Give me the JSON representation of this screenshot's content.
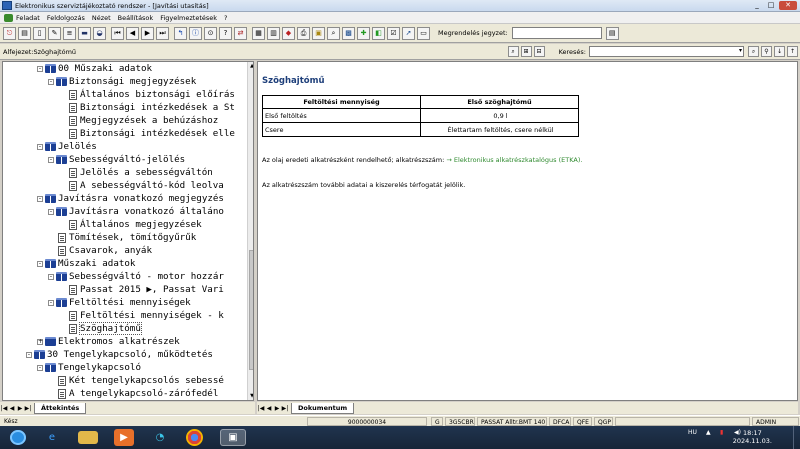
{
  "window": {
    "title": "Elektronikus szerviztájékoztató rendszer - [Javítási utasítás]",
    "minimize": "_",
    "maximize": "□",
    "close": "✕"
  },
  "menu": [
    "Feladat",
    "Feldolgozás",
    "Nézet",
    "Beállítások",
    "Figyelmeztetések",
    "?"
  ],
  "toolbar": {
    "order_label": "Megrendelés jegyzet:",
    "order_value": ""
  },
  "pathbar": {
    "path": "Alfejezet:Szöghajtómű",
    "search_label": "Keresés:",
    "search_value": ""
  },
  "tree": {
    "items": [
      {
        "label": "00 Műszaki adatok",
        "level": 0,
        "type": "book",
        "expander": "-"
      },
      {
        "label": "Biztonsági megjegyzések",
        "level": 1,
        "type": "book",
        "expander": "-"
      },
      {
        "label": "Általános biztonsági előírás",
        "level": 2,
        "type": "page"
      },
      {
        "label": "Biztonsági intézkedések a St",
        "level": 2,
        "type": "page"
      },
      {
        "label": "Megjegyzések a behúzáshoz",
        "level": 2,
        "type": "page"
      },
      {
        "label": "Biztonsági intézkedések elle",
        "level": 2,
        "type": "page"
      },
      {
        "label": "Jelölés",
        "level": 0,
        "type": "book",
        "expander": "-"
      },
      {
        "label": "Sebességváltó-jelölés",
        "level": 1,
        "type": "book",
        "expander": "-"
      },
      {
        "label": "Jelölés a sebességváltón",
        "level": 2,
        "type": "page"
      },
      {
        "label": "A sebességváltó-kód leolva",
        "level": 2,
        "type": "page"
      },
      {
        "label": "Javításra vonatkozó megjegyzés",
        "level": 0,
        "type": "book",
        "expander": "-"
      },
      {
        "label": "Javításra vonatkozó általáno",
        "level": 1,
        "type": "book",
        "expander": "-"
      },
      {
        "label": "Általános megjegyzések",
        "level": 2,
        "type": "page"
      },
      {
        "label": "Tömítések, tömítőgyűrűk",
        "level": 1,
        "type": "page"
      },
      {
        "label": "Csavarok, anyák",
        "level": 1,
        "type": "page"
      },
      {
        "label": "Műszaki adatok",
        "level": 0,
        "type": "book",
        "expander": "-"
      },
      {
        "label": "Sebességváltó - motor hozzár",
        "level": 1,
        "type": "book",
        "expander": "-"
      },
      {
        "label": "Passat 2015 ▶, Passat Vari",
        "level": 2,
        "type": "page"
      },
      {
        "label": "Feltöltési mennyiségek",
        "level": 1,
        "type": "book",
        "expander": "-"
      },
      {
        "label": "Feltöltési mennyiségek - k",
        "level": 2,
        "type": "page"
      },
      {
        "label": "Szöghajtómű",
        "level": 2,
        "type": "page",
        "selected": true
      },
      {
        "label": "Elektromos alkatrészek",
        "level": 0,
        "type": "bookclosed",
        "expander": "+"
      },
      {
        "label": "30 Tengelykapcsoló, működtetés",
        "level": -1,
        "type": "book",
        "expander": "-"
      },
      {
        "label": "Tengelykapcsoló",
        "level": 0,
        "type": "book",
        "expander": "-"
      },
      {
        "label": "Két tengelykapcsolós sebessé",
        "level": 1,
        "type": "page"
      },
      {
        "label": "A tengelykapcsoló-zárófedél",
        "level": 1,
        "type": "page"
      }
    ],
    "tab_label": "Áttekintés"
  },
  "document": {
    "title": "Szöghajtómű",
    "table": {
      "headers": [
        "Feltöltési mennyiség",
        "Első szöghajtómű"
      ],
      "rows": [
        [
          "Első feltöltés",
          "0,9 l"
        ],
        [
          "Csere",
          "Élettartam feltöltés, csere nélkül"
        ]
      ]
    },
    "para1_text": "Az olaj eredeti alkatrészként rendelhető; alkatrészszám: ",
    "para1_link": "→ Elektronikus alkatrészkatalógus (ETKA).",
    "para2": "Az alkatrészszám további adatai a kiszerelés térfogatát jelölik.",
    "tab_label": "Dokumentum"
  },
  "status": {
    "ready": "Kész",
    "number": "9000000034",
    "g": "G",
    "code": "3G5CBR",
    "model": "PASSAT Alltr.BMT 140",
    "dfca": "DFCA",
    "qfe": "QFE",
    "qgp": "QGP",
    "admin": "ADMIN"
  },
  "taskbar": {
    "lang": "HU",
    "time": "18:17",
    "date": "2024.11.03."
  }
}
